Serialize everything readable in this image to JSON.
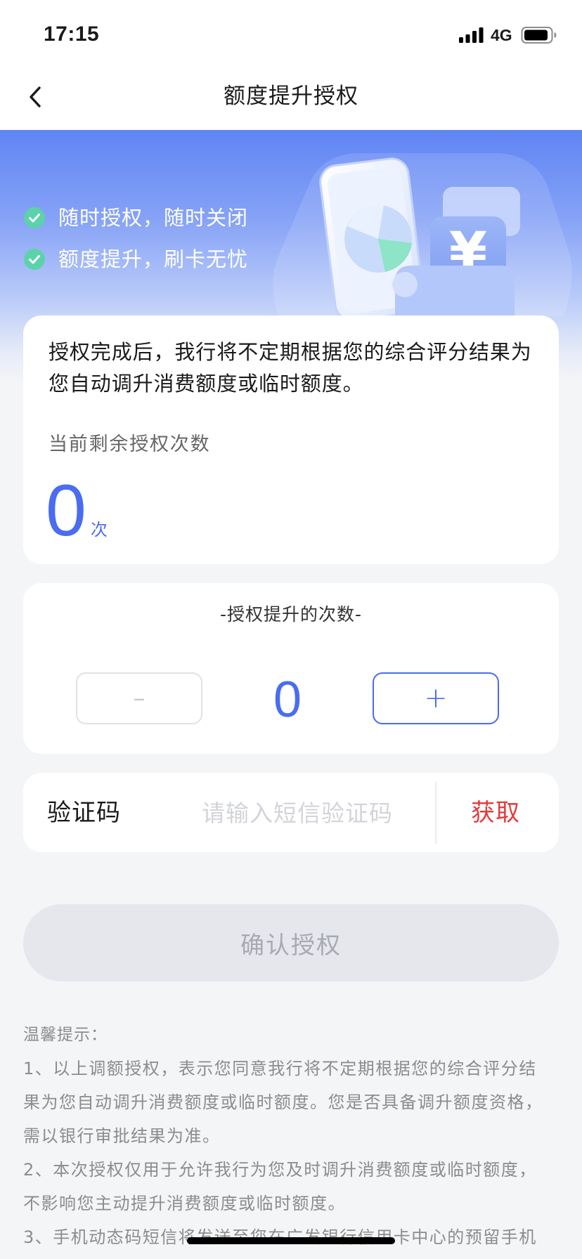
{
  "status_bar": {
    "time": "17:15",
    "network": "4G",
    "signal_icon": "signal-bars-icon",
    "battery_icon": "battery-icon"
  },
  "nav_bar": {
    "back_icon": "chevron-left-icon",
    "title": "额度提升授权"
  },
  "banner": {
    "features": [
      "随时授权，随时关闭",
      "额度提升，刷卡无忧"
    ],
    "feature_icon": "check-circle-icon",
    "illustration": "phone-chart-yuan-illustration",
    "currency_symbol": "¥"
  },
  "info_card": {
    "description_lines": [
      "授权完成后，我行将不定期根据您的综合评分结果为",
      "您自动调升消费额度或临时额度。"
    ],
    "remaining_label": "当前剩余授权次数",
    "remaining_count": "0",
    "remaining_unit": "次"
  },
  "stepper_card": {
    "title": "-授权提升的次数-",
    "decrement_label": "–",
    "decrement_enabled": false,
    "value": "0",
    "increment_label": "+"
  },
  "sms_row": {
    "label": "验证码",
    "placeholder": "请输入短信验证码",
    "value": "",
    "get_code_label": "获取"
  },
  "confirm_button": {
    "label": "确认授权",
    "enabled": false
  },
  "tips": {
    "title": "温馨提示：",
    "lines": [
      "1、以上调额授权，表示您同意我行将不定期根据您的综合评分结",
      "果为您自动调升消费额度或临时额度。您是否具备调升额度资格，",
      "需以银行审批结果为准。",
      "2、本次授权仅用于允许我行为您及时调升消费额度或临时额度，",
      "不影响您主动提升消费额度或临时额度。",
      "3、手机动态码短信将发送至您在广发银行信用卡中心的预留手机"
    ]
  },
  "colors": {
    "accent_blue": "#4a6cf0",
    "banner_blue": "#5f85f4",
    "get_code_red": "#e23b3b",
    "check_green": "#5cd2ab",
    "page_bg": "#f4f5f7",
    "disabled_bg": "#e5e7ec",
    "disabled_text": "#a7aab1"
  }
}
